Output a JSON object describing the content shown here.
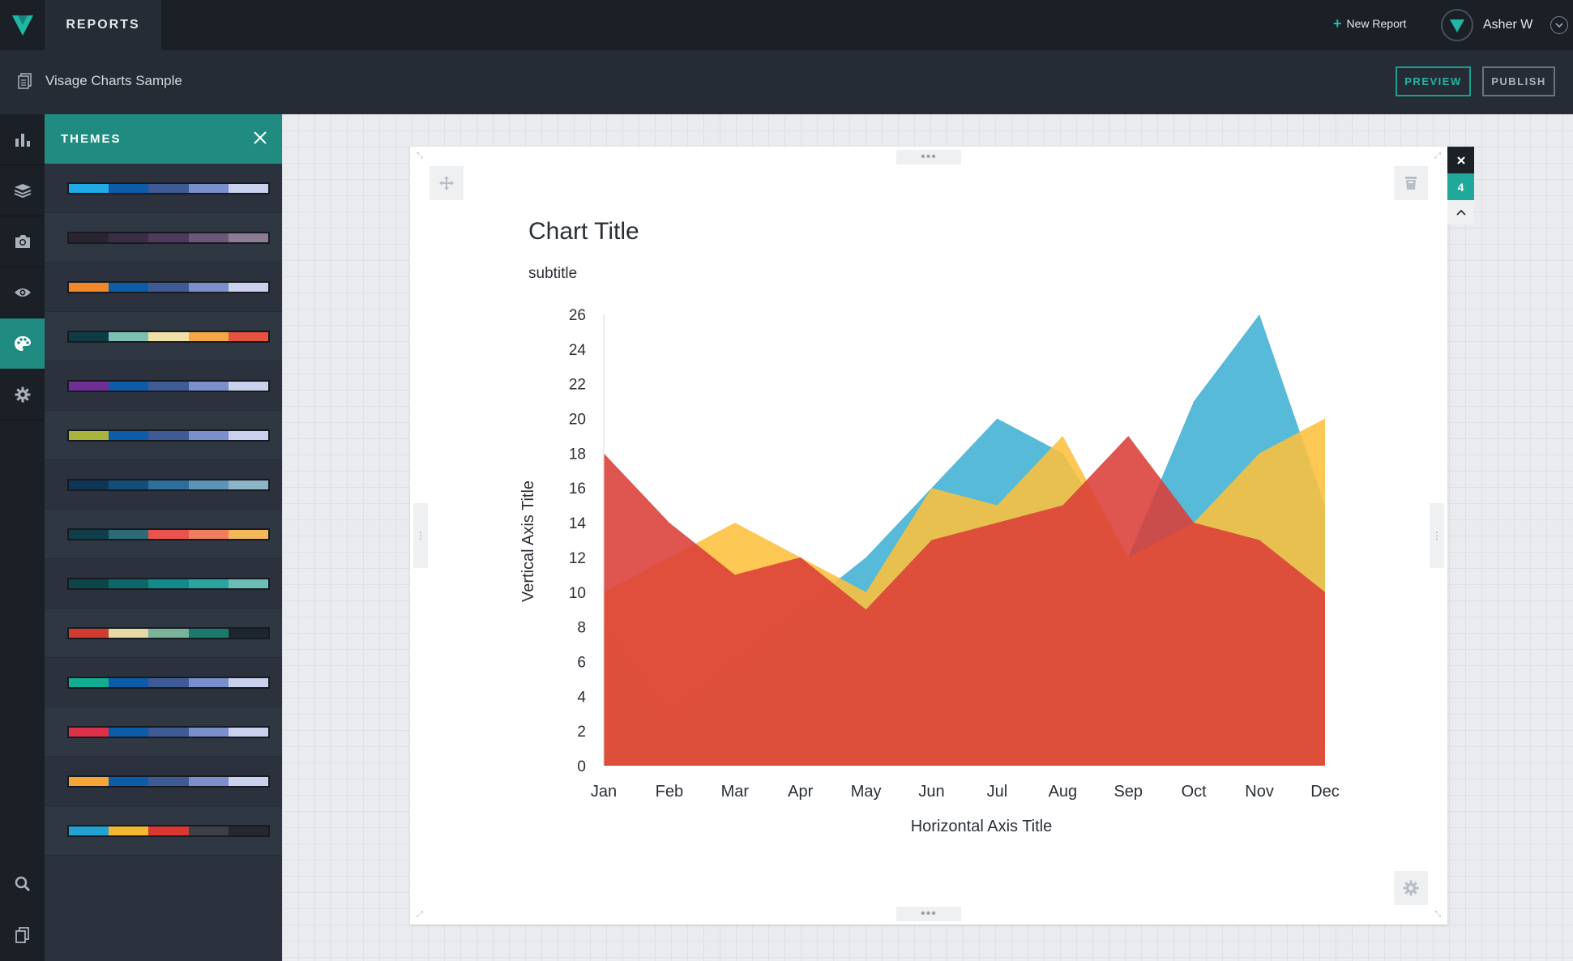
{
  "app": {
    "tab_reports": "REPORTS",
    "new_report_label": "New Report",
    "user_name": "Asher W",
    "accent_color": "#1fb8a6"
  },
  "document": {
    "title": "Visage Charts Sample",
    "preview_label": "PREVIEW",
    "publish_label": "PUBLISH"
  },
  "rail": {
    "items": [
      "bar-chart-icon",
      "layers-icon",
      "camera-icon",
      "eye-icon",
      "palette-icon",
      "gear-icon"
    ],
    "bottom_items": [
      "search-icon",
      "copy-icon"
    ],
    "active": "palette-icon"
  },
  "themes": {
    "title": "THEMES",
    "palettes": [
      [
        "#1fa9e6",
        "#0d5ca8",
        "#3f5b96",
        "#7a8fcb",
        "#c9d1ec"
      ],
      [
        "#2a2430",
        "#3b2d44",
        "#4e3b5c",
        "#6b5878",
        "#8b7c93"
      ],
      [
        "#f1892b",
        "#0d5ca8",
        "#3f5b96",
        "#7a8fcb",
        "#c9d1ec"
      ],
      [
        "#0f3b45",
        "#7cbfb3",
        "#eee0a6",
        "#f3a745",
        "#e5533f"
      ],
      [
        "#6f2f95",
        "#0d5ca8",
        "#3f5b96",
        "#7a8fcb",
        "#c9d1ec"
      ],
      [
        "#aab43c",
        "#0d5ca8",
        "#3f5b96",
        "#7a8fcb",
        "#c9d1ec"
      ],
      [
        "#0f3557",
        "#144d7a",
        "#2c6f9d",
        "#5d93b4",
        "#8cb4c7"
      ],
      [
        "#0f3e48",
        "#2d6a78",
        "#e9534c",
        "#f07d5b",
        "#f4b759"
      ],
      [
        "#0d4649",
        "#0d6668",
        "#138a8c",
        "#2ba3a0",
        "#6bbdb5"
      ],
      [
        "#d23b2f",
        "#e5d9a6",
        "#79b39a",
        "#1b7a6c",
        "#1d2530"
      ],
      [
        "#12ad90",
        "#0d5ca8",
        "#3f5b96",
        "#7a8fcb",
        "#c9d1ec"
      ],
      [
        "#dc3148",
        "#0d5ca8",
        "#3f5b96",
        "#7a8fcb",
        "#c9d1ec"
      ],
      [
        "#f6a536",
        "#0d5ca8",
        "#3f5b96",
        "#7a8fcb",
        "#c9d1ec"
      ],
      [
        "#23a2d3",
        "#f4b731",
        "#d9372f",
        "#3d4048",
        "#25282e"
      ]
    ]
  },
  "widget": {
    "badge_count": "4"
  },
  "chart_data": {
    "type": "area",
    "title": "Chart Title",
    "subtitle": "subtitle",
    "xlabel": "Horizontal Axis Title",
    "ylabel": "Vertical Axis Title",
    "categories": [
      "Jan",
      "Feb",
      "Mar",
      "Apr",
      "May",
      "Jun",
      "Jul",
      "Aug",
      "Sep",
      "Oct",
      "Nov",
      "Dec"
    ],
    "ylim": [
      0,
      26
    ],
    "yticks": [
      0,
      2,
      4,
      6,
      8,
      10,
      12,
      14,
      16,
      18,
      20,
      22,
      24,
      26
    ],
    "series": [
      {
        "color": "#3fb0d3",
        "values": [
          8,
          3,
          6,
          9,
          12,
          16,
          20,
          18,
          12,
          21,
          26,
          15
        ]
      },
      {
        "color": "#fdc03c",
        "values": [
          10,
          12,
          14,
          12,
          10,
          16,
          15,
          19,
          12,
          14,
          18,
          20
        ]
      },
      {
        "color": "#db3e38",
        "values": [
          18,
          14,
          11,
          12,
          9,
          13,
          14,
          15,
          19,
          14,
          13,
          10
        ]
      }
    ],
    "grid": false,
    "legend": "none"
  }
}
